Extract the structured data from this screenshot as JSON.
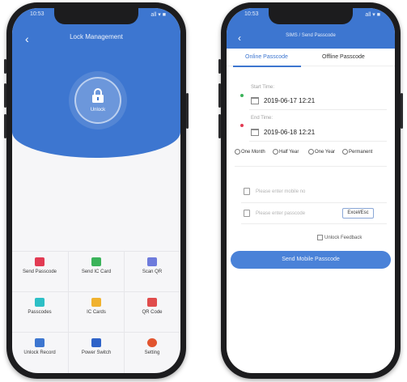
{
  "left_phone": {
    "status": {
      "time": "10:53",
      "signal": "all ▾ ■"
    },
    "title": "Lock Management",
    "back_glyph": "‹",
    "lock": {
      "icon": "lock-icon",
      "label": "Unlock"
    },
    "grid": [
      {
        "label": "Send Passcode",
        "icon": "send-passcode-icon",
        "color": "#e23b53"
      },
      {
        "label": "Send IC Card",
        "icon": "ic-card-icon",
        "color": "#3bb35a"
      },
      {
        "label": "Scan QR",
        "icon": "qr-scan-icon",
        "color": "#6e7bdc"
      },
      {
        "label": "Passcodes",
        "icon": "passcodes-icon",
        "color": "#2dbfc6"
      },
      {
        "label": "IC Cards",
        "icon": "ic-cards-icon",
        "color": "#f0b22f"
      },
      {
        "label": "QR Code",
        "icon": "qr-code-icon",
        "color": "#e04c4c"
      },
      {
        "label": "Unlock Record",
        "icon": "unlock-record-icon",
        "color": "#3d76d0"
      },
      {
        "label": "Power Switch",
        "icon": "power-switch-icon",
        "color": "#2f63c8"
      },
      {
        "label": "Setting",
        "icon": "setting-icon",
        "color": "#e2542f"
      }
    ]
  },
  "right_phone": {
    "status": {
      "time": "10:53",
      "signal": "all ▾ ■"
    },
    "title": "SIMS / Send Passcode",
    "back_glyph": "‹",
    "tabs": {
      "active": "Online Passcode",
      "inactive": "Offline Passcode"
    },
    "start_time": {
      "label": "Start Time:",
      "value": "2019-06-17 12:21"
    },
    "end_time": {
      "label": "End Time:",
      "value": "2019-06-18 12:21"
    },
    "durations": [
      "One Month",
      "Half Year",
      "One Year",
      "Permanent"
    ],
    "phone_field": {
      "placeholder": "Please enter mobile no"
    },
    "passcode_field": {
      "placeholder": "Please enter passcode",
      "button": "Excel/Esc"
    },
    "feedback_label": "Unlock Feedback",
    "submit_label": "Send Mobile Passcode",
    "accent": "#3d76d0"
  }
}
